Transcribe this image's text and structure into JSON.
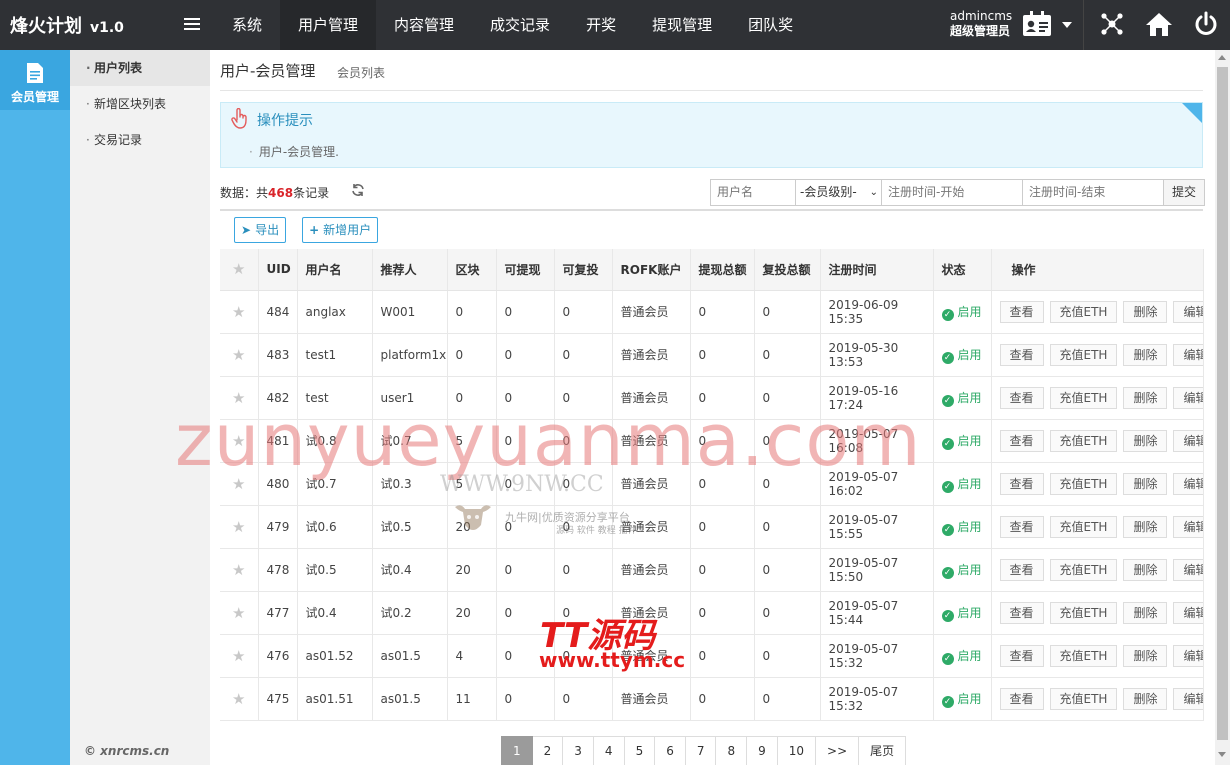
{
  "app": {
    "title": "烽火计划",
    "version": "v1.0"
  },
  "nav": [
    "系统",
    "用户管理",
    "内容管理",
    "成交记录",
    "开奖",
    "提现管理",
    "团队奖"
  ],
  "user": {
    "name": "admincms",
    "role": "超级管理员"
  },
  "sidebar": {
    "module": "会员管理"
  },
  "submenu": [
    "用户列表",
    "新增区块列表",
    "交易记录"
  ],
  "footer": {
    "copyright": "© xnrcms.cn"
  },
  "page": {
    "title": "用户-会员管理",
    "subtitle": "会员列表"
  },
  "tips": {
    "title": "操作提示",
    "text": "用户-会员管理."
  },
  "summary": {
    "prefix": "数据：共",
    "total": "468",
    "suffix": "条记录"
  },
  "filter": {
    "username_placeholder": "用户名",
    "level_selected": "-会员级别-",
    "start_placeholder": "注册时间-开始",
    "end_placeholder": "注册时间-结束",
    "submit_label": "提交"
  },
  "toolbar": {
    "export_label": "导出",
    "add_label": "新增用户"
  },
  "table": {
    "headers": [
      "UID",
      "用户名",
      "推荐人",
      "区块",
      "可提现",
      "可复投",
      "ROFK账户",
      "提现总额",
      "复投总额",
      "注册时间",
      "状态",
      "操作"
    ],
    "actions": [
      "查看",
      "充值ETH",
      "删除",
      "编辑"
    ],
    "rows": [
      {
        "uid": "484",
        "username": "anglax",
        "referrer": "W001",
        "block": "0",
        "withdrawable": "0",
        "reinvestable": "0",
        "account": "普通会员",
        "withdraw_total": "0",
        "reinvest_total": "0",
        "reg_date": "2019-06-09",
        "reg_time": "15:35",
        "status": "启用"
      },
      {
        "uid": "483",
        "username": "test1",
        "referrer": "platform1x",
        "block": "0",
        "withdrawable": "0",
        "reinvestable": "0",
        "account": "普通会员",
        "withdraw_total": "0",
        "reinvest_total": "0",
        "reg_date": "2019-05-30",
        "reg_time": "13:53",
        "status": "启用"
      },
      {
        "uid": "482",
        "username": "test",
        "referrer": "user1",
        "block": "0",
        "withdrawable": "0",
        "reinvestable": "0",
        "account": "普通会员",
        "withdraw_total": "0",
        "reinvest_total": "0",
        "reg_date": "2019-05-16",
        "reg_time": "17:24",
        "status": "启用"
      },
      {
        "uid": "481",
        "username": "试0.8",
        "referrer": "试0.7",
        "block": "5",
        "withdrawable": "0",
        "reinvestable": "0",
        "account": "普通会员",
        "withdraw_total": "0",
        "reinvest_total": "0",
        "reg_date": "2019-05-07",
        "reg_time": "16:08",
        "status": "启用"
      },
      {
        "uid": "480",
        "username": "试0.7",
        "referrer": "试0.3",
        "block": "5",
        "withdrawable": "0",
        "reinvestable": "0",
        "account": "普通会员",
        "withdraw_total": "0",
        "reinvest_total": "0",
        "reg_date": "2019-05-07",
        "reg_time": "16:02",
        "status": "启用"
      },
      {
        "uid": "479",
        "username": "试0.6",
        "referrer": "试0.5",
        "block": "20",
        "withdrawable": "0",
        "reinvestable": "0",
        "account": "普通会员",
        "withdraw_total": "0",
        "reinvest_total": "0",
        "reg_date": "2019-05-07",
        "reg_time": "15:55",
        "status": "启用"
      },
      {
        "uid": "478",
        "username": "试0.5",
        "referrer": "试0.4",
        "block": "20",
        "withdrawable": "0",
        "reinvestable": "0",
        "account": "普通会员",
        "withdraw_total": "0",
        "reinvest_total": "0",
        "reg_date": "2019-05-07",
        "reg_time": "15:50",
        "status": "启用"
      },
      {
        "uid": "477",
        "username": "试0.4",
        "referrer": "试0.2",
        "block": "20",
        "withdrawable": "0",
        "reinvestable": "0",
        "account": "普通会员",
        "withdraw_total": "0",
        "reinvest_total": "0",
        "reg_date": "2019-05-07",
        "reg_time": "15:44",
        "status": "启用"
      },
      {
        "uid": "476",
        "username": "as01.52",
        "referrer": "as01.5",
        "block": "4",
        "withdrawable": "0",
        "reinvestable": "0",
        "account": "普通会员",
        "withdraw_total": "0",
        "reinvest_total": "0",
        "reg_date": "2019-05-07",
        "reg_time": "15:32",
        "status": "启用"
      },
      {
        "uid": "475",
        "username": "as01.51",
        "referrer": "as01.5",
        "block": "11",
        "withdrawable": "0",
        "reinvestable": "0",
        "account": "普通会员",
        "withdraw_total": "0",
        "reinvest_total": "0",
        "reg_date": "2019-05-07",
        "reg_time": "15:32",
        "status": "启用"
      }
    ]
  },
  "pagination": [
    "1",
    "2",
    "3",
    "4",
    "5",
    "6",
    "7",
    "8",
    "9",
    "10",
    ">>",
    "尾页"
  ],
  "watermarks": {
    "large": "zunyueyuanma.com",
    "site": "WWW.9NW.CC",
    "site_sub": "九牛网|优质资源分享平台",
    "site_sub2": "源码 软件 教程 插件",
    "brand": "TT源码",
    "brand_url": "www.ttym.cc"
  },
  "colors": {
    "topbar": "#2f3135",
    "sidebar": "#4fb5ea",
    "accent": "#3aa6e0",
    "total_count": "#d9242a",
    "status_ok": "#2eaa67"
  }
}
